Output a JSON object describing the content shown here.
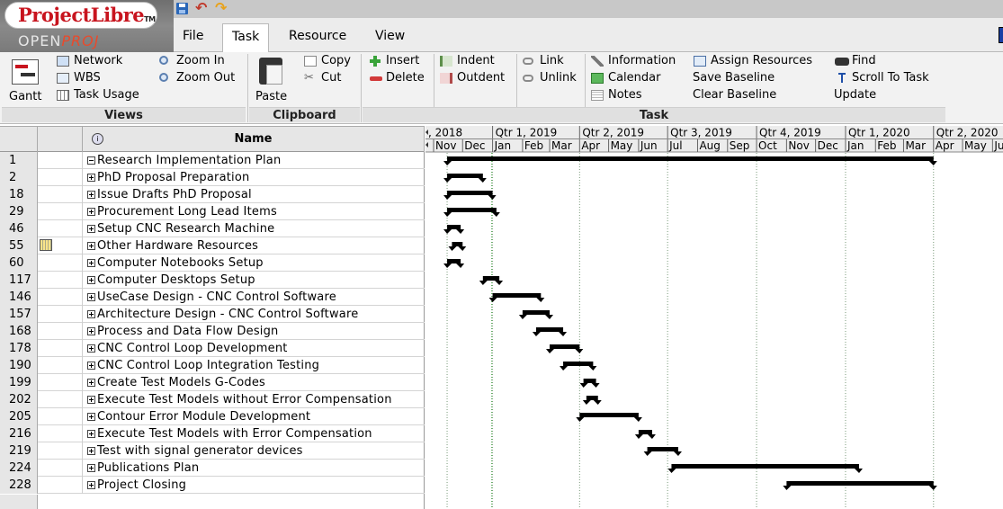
{
  "app": {
    "name": "ProjectLibre",
    "tm": "TM",
    "sub_left": "OPEN",
    "sub_right": "PROJ"
  },
  "menu": {
    "tabs": [
      "File",
      "Task",
      "Resource",
      "View"
    ],
    "active": "Task"
  },
  "ribbon": {
    "views": {
      "label": "Views",
      "gantt": "Gantt",
      "network": "Network",
      "wbs": "WBS",
      "task_usage": "Task Usage",
      "zoom_in": "Zoom In",
      "zoom_out": "Zoom Out"
    },
    "clipboard": {
      "label": "Clipboard",
      "paste": "Paste",
      "copy": "Copy",
      "cut": "Cut"
    },
    "task": {
      "label": "Task",
      "insert": "Insert",
      "delete": "Delete",
      "indent": "Indent",
      "outdent": "Outdent",
      "link": "Link",
      "unlink": "Unlink",
      "information": "Information",
      "calendar": "Calendar",
      "notes": "Notes",
      "assign_resources": "Assign Resources",
      "save_baseline": "Save Baseline",
      "clear_baseline": "Clear Baseline",
      "find": "Find",
      "scroll_to_task": "Scroll To Task",
      "update": "Update"
    }
  },
  "table": {
    "header_name": "Name",
    "rows": [
      {
        "id": "1",
        "name": "Research Implementation Plan",
        "expand": "minus",
        "indicator": ""
      },
      {
        "id": "2",
        "name": "PhD Proposal Preparation",
        "expand": "plus",
        "indicator": ""
      },
      {
        "id": "18",
        "name": "Issue Drafts PhD Proposal",
        "expand": "plus",
        "indicator": ""
      },
      {
        "id": "29",
        "name": "Procurement Long Lead Items",
        "expand": "plus",
        "indicator": ""
      },
      {
        "id": "46",
        "name": "Setup CNC Research Machine",
        "expand": "plus",
        "indicator": ""
      },
      {
        "id": "55",
        "name": "Other Hardware Resources",
        "expand": "plus",
        "indicator": "calendar"
      },
      {
        "id": "60",
        "name": "Computer Notebooks Setup",
        "expand": "plus",
        "indicator": ""
      },
      {
        "id": "117",
        "name": "Computer Desktops Setup",
        "expand": "plus",
        "indicator": ""
      },
      {
        "id": "146",
        "name": "UseCase Design - CNC Control Software",
        "expand": "plus",
        "indicator": ""
      },
      {
        "id": "157",
        "name": "Architecture Design - CNC Control Software",
        "expand": "plus",
        "indicator": ""
      },
      {
        "id": "168",
        "name": "Process and Data Flow Design",
        "expand": "plus",
        "indicator": ""
      },
      {
        "id": "178",
        "name": "CNC Control Loop Development",
        "expand": "plus",
        "indicator": ""
      },
      {
        "id": "190",
        "name": "CNC Control Loop Integration Testing",
        "expand": "plus",
        "indicator": ""
      },
      {
        "id": "199",
        "name": "Create Test Models G-Codes",
        "expand": "plus",
        "indicator": ""
      },
      {
        "id": "202",
        "name": "Execute Test Models without Error Compensation",
        "expand": "plus",
        "indicator": ""
      },
      {
        "id": "205",
        "name": "Contour Error Module Development",
        "expand": "plus",
        "indicator": ""
      },
      {
        "id": "216",
        "name": "Execute Test Models with Error Compensation",
        "expand": "plus",
        "indicator": ""
      },
      {
        "id": "219",
        "name": "Test with signal generator devices",
        "expand": "plus",
        "indicator": ""
      },
      {
        "id": "224",
        "name": "Publications Plan",
        "expand": "plus",
        "indicator": ""
      },
      {
        "id": "228",
        "name": "Project Closing",
        "expand": "plus",
        "indicator": ""
      }
    ]
  },
  "gantt": {
    "quarters": [
      ", 2018",
      "Qtr 1, 2019",
      "Qtr 2, 2019",
      "Qtr 3, 2019",
      "Qtr 4, 2019",
      "Qtr 1, 2020",
      "Qtr 2, 2020"
    ],
    "months": [
      "Nov",
      "Dec",
      "Jan",
      "Feb",
      "Mar",
      "Apr",
      "May",
      "Jun",
      "Jul",
      "Aug",
      "Sep",
      "Oct",
      "Nov",
      "Dec",
      "Jan",
      "Feb",
      "Mar",
      "Apr",
      "May",
      "Ju"
    ],
    "timescale_start": "2018-11-01",
    "bars": [
      {
        "id": "1",
        "start": "2018-11-15",
        "finish": "2020-04-01"
      },
      {
        "id": "2",
        "start": "2018-11-15",
        "finish": "2018-12-22"
      },
      {
        "id": "18",
        "start": "2018-11-15",
        "finish": "2019-01-01"
      },
      {
        "id": "29",
        "start": "2018-11-15",
        "finish": "2019-01-05"
      },
      {
        "id": "46",
        "start": "2018-11-15",
        "finish": "2018-11-29"
      },
      {
        "id": "55",
        "start": "2018-11-20",
        "finish": "2018-12-01"
      },
      {
        "id": "60",
        "start": "2018-11-15",
        "finish": "2018-11-29"
      },
      {
        "id": "117",
        "start": "2018-12-22",
        "finish": "2019-01-08"
      },
      {
        "id": "146",
        "start": "2019-01-01",
        "finish": "2019-02-20"
      },
      {
        "id": "157",
        "start": "2019-02-01",
        "finish": "2019-03-01"
      },
      {
        "id": "168",
        "start": "2019-02-15",
        "finish": "2019-03-15"
      },
      {
        "id": "178",
        "start": "2019-03-01",
        "finish": "2019-04-01"
      },
      {
        "id": "190",
        "start": "2019-03-15",
        "finish": "2019-04-15"
      },
      {
        "id": "199",
        "start": "2019-04-05",
        "finish": "2019-04-18"
      },
      {
        "id": "202",
        "start": "2019-04-08",
        "finish": "2019-04-20"
      },
      {
        "id": "205",
        "start": "2019-04-01",
        "finish": "2019-06-01"
      },
      {
        "id": "216",
        "start": "2019-06-01",
        "finish": "2019-06-15"
      },
      {
        "id": "219",
        "start": "2019-06-10",
        "finish": "2019-07-12"
      },
      {
        "id": "224",
        "start": "2019-07-05",
        "finish": "2020-01-15"
      },
      {
        "id": "228",
        "start": "2019-11-01",
        "finish": "2020-04-01"
      }
    ]
  }
}
